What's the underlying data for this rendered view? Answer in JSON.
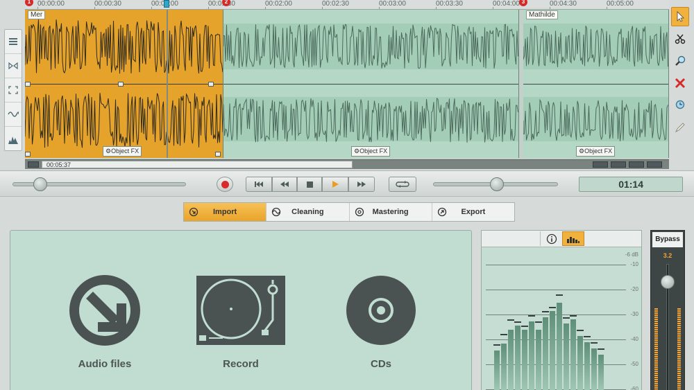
{
  "timeline": {
    "ruler_ticks": [
      "00:00:00",
      "00:00:30",
      "00:01:00",
      "00:01:30",
      "00:02:00",
      "00:02:30",
      "00:03:00",
      "00:03:30",
      "00:04:00",
      "00:04:30",
      "00:05:00"
    ],
    "markers": [
      "1",
      "2",
      "3"
    ],
    "clips": [
      {
        "label": "Mer",
        "fx_label": "Object FX",
        "selected": true
      },
      {
        "label": "",
        "fx_label": "Object FX",
        "selected": false
      },
      {
        "label": "Mathilde",
        "fx_label": "Object FX",
        "selected": false
      }
    ],
    "scroll_position": "00:05:37",
    "left_tools": [
      "tracks-icon",
      "stereo-icon",
      "region-icon",
      "waveform-icon",
      "spectrum-icon"
    ],
    "right_tools": [
      "pointer-icon",
      "scissors-icon",
      "zoom-icon",
      "delete-icon",
      "magnify-icon",
      "pencil-icon"
    ]
  },
  "transport": {
    "time": "01:14",
    "buttons": [
      "record",
      "skip-back",
      "rewind",
      "stop",
      "play",
      "fast-forward",
      "loop"
    ],
    "position_fraction": 0.16,
    "volume_fraction": 0.51
  },
  "tabs": [
    {
      "label": "Import",
      "icon": "import-icon",
      "active": true
    },
    {
      "label": "Cleaning",
      "icon": "cleaning-icon",
      "active": false
    },
    {
      "label": "Mastering",
      "icon": "mastering-icon",
      "active": false
    },
    {
      "label": "Export",
      "icon": "export-icon",
      "active": false
    }
  ],
  "import_options": [
    {
      "label": "Audio files",
      "icon": "audio-files-icon"
    },
    {
      "label": "Record",
      "icon": "turntable-icon"
    },
    {
      "label": "CDs",
      "icon": "cd-icon"
    }
  ],
  "meter": {
    "db_labels": [
      "-6 dB",
      "-10",
      "-20",
      "-30",
      "-40",
      "-50",
      "-60"
    ],
    "levels": [
      0.38,
      0.45,
      0.58,
      0.62,
      0.58,
      0.66,
      0.58,
      0.7,
      0.76,
      0.84,
      0.64,
      0.68,
      0.52,
      0.46,
      0.4,
      0.34
    ],
    "peaks": [
      0.44,
      0.54,
      0.68,
      0.66,
      0.62,
      0.72,
      0.66,
      0.76,
      0.8,
      0.92,
      0.7,
      0.72,
      0.58,
      0.52,
      0.46,
      0.4
    ]
  },
  "bypass": {
    "label": "Bypass",
    "value": "3.2",
    "level_fraction": 0.86
  },
  "colors": {
    "accent": "#f0a93a",
    "clip_selected": "#e5a32c",
    "clip_normal": "#b5d8c6",
    "waveform": "#3b4a43",
    "panel": "#c1ddd1",
    "record": "#d92a2a"
  }
}
